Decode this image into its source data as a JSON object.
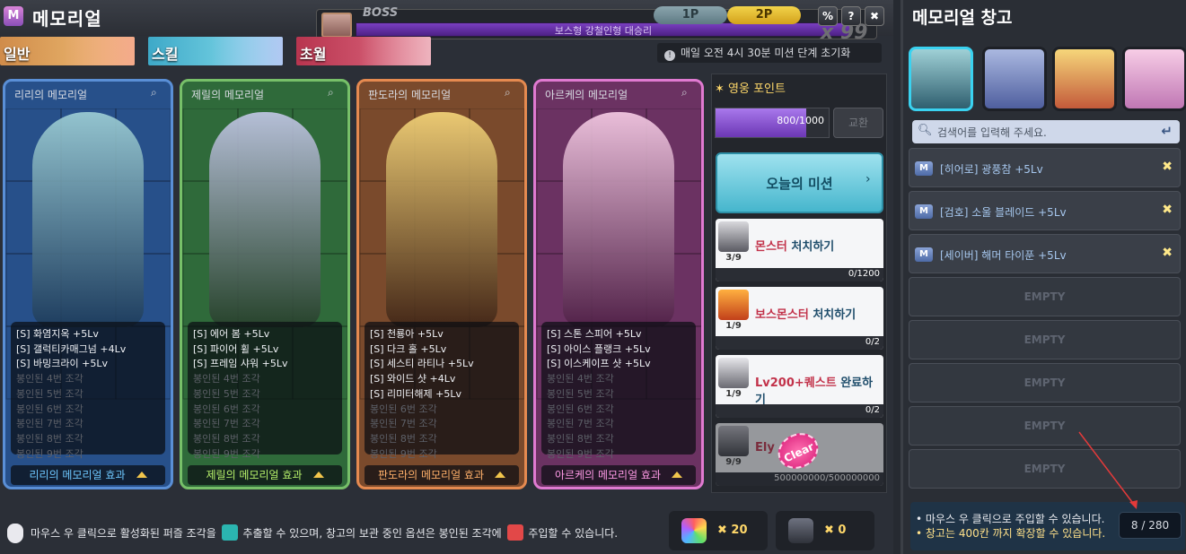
{
  "header": {
    "title": "메모리얼",
    "boss_label": "BOSS",
    "boss_name": "보스형 강철인형 대승리",
    "boss_multiplier": "x 99",
    "player_tabs": [
      "1P",
      "2P"
    ],
    "buttons": [
      "%",
      "?",
      "✖"
    ]
  },
  "tabs": [
    {
      "label": "일반"
    },
    {
      "label": "스킬"
    },
    {
      "label": "초월"
    }
  ],
  "notice": "매일 오전 4시 30분 미션 단계 초기화",
  "cards": [
    {
      "header": "리리의 메모리얼",
      "color": "#27508a",
      "border": "#5a8fd6",
      "skills": [
        "[S] 화염지옥 +5Lv",
        "[S] 갤럭티카매그넘 +4Lv",
        "[S] 바밍크라이 +5Lv"
      ],
      "sealed": [
        "봉인된 4번 조각",
        "봉인된 5번 조각",
        "봉인된 6번 조각",
        "봉인된 7번 조각",
        "봉인된 8번 조각",
        "봉인된 9번 조각"
      ],
      "footer": "리리의 메모리얼 효과",
      "footer_color": "#6ec8ff"
    },
    {
      "header": "제릴의 메모리얼",
      "color": "#2f6a3a",
      "border": "#77c069",
      "skills": [
        "[S] 에어 봄 +5Lv",
        "[S] 파이어 휠 +5Lv",
        "[S] 프레임 샤워 +5Lv"
      ],
      "sealed": [
        "봉인된 4번 조각",
        "봉인된 5번 조각",
        "봉인된 6번 조각",
        "봉인된 7번 조각",
        "봉인된 8번 조각",
        "봉인된 9번 조각"
      ],
      "footer": "제릴의 메모리얼 효과",
      "footer_color": "#b6f06a"
    },
    {
      "header": "판도라의 메모리얼",
      "color": "#7a4a2c",
      "border": "#e58a50",
      "skills": [
        "[S] 천룡아 +5Lv",
        "[S] 다크 홀 +5Lv",
        "[S] 세스티 라티나 +5Lv",
        "[S] 와이드 샷 +4Lv",
        "[S] 리미터해제 +5Lv"
      ],
      "sealed": [
        "봉인된 6번 조각",
        "봉인된 7번 조각",
        "봉인된 8번 조각",
        "봉인된 9번 조각"
      ],
      "footer": "판도라의 메모리얼 효과",
      "footer_color": "#ffb06a"
    },
    {
      "header": "아르케의 메모리얼",
      "color": "#6b3262",
      "border": "#e07ad1",
      "skills": [
        "[S] 스톤 스피어 +5Lv",
        "[S] 아이스 플랭크 +5Lv",
        "[S] 이스케이프 샷 +5Lv"
      ],
      "sealed": [
        "봉인된 4번 조각",
        "봉인된 5번 조각",
        "봉인된 6번 조각",
        "봉인된 7번 조각",
        "봉인된 8번 조각",
        "봉인된 9번 조각"
      ],
      "footer": "아르케의 메모리얼 효과",
      "footer_color": "#ff9ae6"
    }
  ],
  "hero_points": {
    "title": "영웅 포인트",
    "value": "800/1000",
    "fraction": 0.8,
    "exchange": "교환"
  },
  "missions": {
    "header": "오늘의 미션",
    "items": [
      {
        "name_a": "몬스터",
        "name_b": "처치하기",
        "count": "3/9",
        "progress": "0/1200"
      },
      {
        "name_a": "보스몬스터",
        "name_b": "처치하기",
        "count": "1/9",
        "progress": "0/2"
      },
      {
        "name_a": "Lv200+퀘스트",
        "name_b": "완료하기",
        "count": "1/9",
        "progress": "0/2"
      },
      {
        "name_a": "Ely",
        "name_b": "",
        "count": "9/9",
        "progress": "500000000/500000000",
        "clear": "Clear"
      }
    ]
  },
  "bottom": {
    "hint_a": "마우스 우 클릭으로 활성화된 퍼즐 조각을",
    "hint_b": "추출할 수 있으며, 창고의 보관 중인 옵션은 봉인된 조각에",
    "hint_c": "주입할 수 있습니다.",
    "currency": [
      {
        "icon": "memorial-gem-icon",
        "value": "20"
      },
      {
        "icon": "extract-stone-icon",
        "value": "0"
      }
    ]
  },
  "storage": {
    "title": "메모리얼 창고",
    "search_placeholder": "검색어를 입력해 주세요.",
    "slots": [
      {
        "text": "[히어로] 광풍참 +5Lv"
      },
      {
        "text": "[검호] 소울 블레이드 +5Lv"
      },
      {
        "text": "[세이버] 해머 타이푼 +5Lv"
      },
      {
        "text": "EMPTY"
      },
      {
        "text": "EMPTY"
      },
      {
        "text": "EMPTY"
      },
      {
        "text": "EMPTY"
      },
      {
        "text": "EMPTY"
      }
    ],
    "hint1": "• 마우스 우 클릭으로 주입할 수 있습니다.",
    "hint2": "• 창고는 400칸 까지 확장할 수 있습니다.",
    "count": "8 / 280"
  }
}
